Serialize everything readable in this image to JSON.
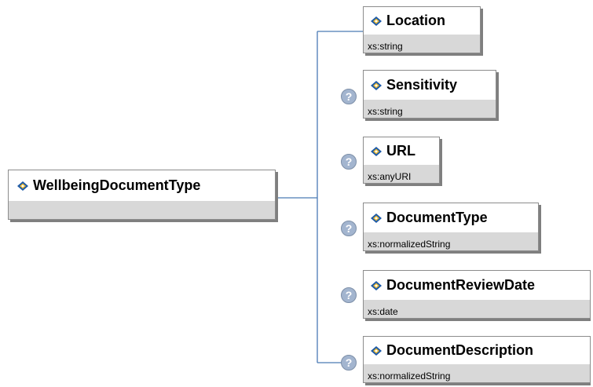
{
  "root": {
    "name": "WellbeingDocumentType",
    "icon": "element-icon"
  },
  "children": [
    {
      "name": "Location",
      "type": "xs:string",
      "optional": false,
      "icon": "element-icon"
    },
    {
      "name": "Sensitivity",
      "type": "xs:string",
      "optional": true,
      "icon": "element-icon"
    },
    {
      "name": "URL",
      "type": "xs:anyURI",
      "optional": true,
      "icon": "element-icon"
    },
    {
      "name": "DocumentType",
      "type": "xs:normalizedString",
      "optional": true,
      "icon": "element-icon"
    },
    {
      "name": "DocumentReviewDate",
      "type": "xs:date",
      "optional": true,
      "icon": "element-icon"
    },
    {
      "name": "DocumentDescription",
      "type": "xs:normalizedString",
      "optional": true,
      "icon": "element-icon"
    }
  ],
  "optional_marker": "?",
  "colors": {
    "connector": "#4a7ab5",
    "header_bg": "#ffffff",
    "body_bg": "#d8d8d8",
    "shadow": "#7f7f7f",
    "question_fill": "#a3b5cf",
    "icon_blue": "#1d5aa8",
    "icon_gold": "#e8b830"
  }
}
